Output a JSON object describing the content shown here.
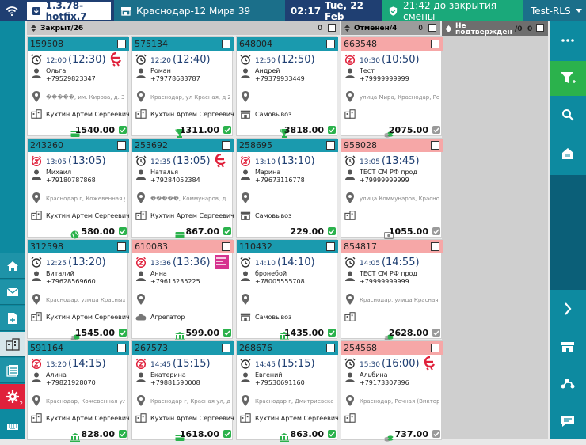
{
  "header": {
    "version": "1.3.78-hotfix.7",
    "store": "Краснодар-12 Мира 39",
    "time": "02:17",
    "date": "Tue, 22 Feb",
    "shift": "21:42 до закрытия смены",
    "user": "Test-RLS"
  },
  "columns": [
    {
      "title": "Закрыт/26",
      "count": "0"
    },
    {
      "title": "Отменен/4",
      "count": "0"
    },
    {
      "title": "Не подтвержден",
      "count": "/0",
      "count2": "0"
    }
  ],
  "cards": [
    {
      "id": "159508",
      "hdr": "teal",
      "time": "12:00",
      "eta": "(12:30)",
      "name": "Ольга",
      "phone": "+79529823347",
      "addr": "�����, им. Кирова, д. 3",
      "courier": "Кухтин Артем Сергеевич",
      "price": "1540.00",
      "pay": "card",
      "status": "g",
      "clock": "alarm",
      "brand": "e"
    },
    {
      "id": "575134",
      "hdr": "teal",
      "time": "12:20",
      "eta": "(12:40)",
      "name": "Роман",
      "phone": "+79778683787",
      "addr": "Краснодар, ул Красная, д 25/",
      "courier": "Кухтин Артем Сергеевич",
      "price": "1311.00",
      "pay": "trophy",
      "status": "g",
      "clock": "alarm",
      "brand": ""
    },
    {
      "id": "648004",
      "hdr": "teal",
      "time": "12:50",
      "eta": "(12:50)",
      "name": "Андрей",
      "phone": "+79379933449",
      "addr": "",
      "courier": "Самовывоз",
      "price": "3818.00",
      "pay": "trophy",
      "status": "g",
      "clock": "alarm",
      "brand": "",
      "courierIcon": "store"
    },
    {
      "id": "663548",
      "hdr": "pink",
      "time": "10:30",
      "eta": "(10:50)",
      "name": "Тест",
      "phone": "+79999999999",
      "addr": "улица Мира, Краснодар, Росс",
      "courier": "",
      "price": "2075.00",
      "pay": "coins",
      "status": "gr",
      "clock": "z",
      "brand": ""
    },
    {
      "id": "243260",
      "hdr": "teal",
      "time": "13:05",
      "eta": "(13:05)",
      "name": "Михаил",
      "phone": "+79180787868",
      "addr": "Краснодар г, Кожевенная ул,",
      "courier": "Кухтин Артем Сергеевич",
      "price": "580.00",
      "pay": "globe",
      "status": "g",
      "clock": "z",
      "brand": ""
    },
    {
      "id": "253692",
      "hdr": "teal",
      "time": "12:35",
      "eta": "(13:05)",
      "name": "Наталья",
      "phone": "+79284052384",
      "addr": "�����, Коммунаров, д. 7",
      "courier": "Кухтин Артем Сергеевич",
      "price": "867.00",
      "pay": "card",
      "status": "g",
      "clock": "alarm",
      "brand": "e"
    },
    {
      "id": "258695",
      "hdr": "teal",
      "time": "13:10",
      "eta": "(13:10)",
      "name": "Марина",
      "phone": "+79673116778",
      "addr": "",
      "courier": "Самовывоз",
      "price": "229.00",
      "pay": "",
      "status": "g",
      "clock": "z",
      "brand": "",
      "courierIcon": "store"
    },
    {
      "id": "958028",
      "hdr": "pink",
      "time": "13:05",
      "eta": "(13:45)",
      "name": "ТЕСТ СМ РФ прод",
      "phone": "+79999999999",
      "addr": "улица Коммунаров, Краснодар",
      "courier": "",
      "price": "1055.00",
      "pay": "cash",
      "status": "gr",
      "clock": "alarm",
      "brand": ""
    },
    {
      "id": "312598",
      "hdr": "teal",
      "time": "12:25",
      "eta": "(13:20)",
      "name": "Виталий",
      "phone": "+79628569660",
      "addr": "Краснодар, улица Красных П",
      "courier": "Кухтин Артем Сергеевич",
      "price": "1545.00",
      "pay": "coins",
      "status": "g",
      "clock": "alarm",
      "brand": ""
    },
    {
      "id": "610083",
      "hdr": "pink",
      "time": "13:36",
      "eta": "(13:36)",
      "name": "Анна",
      "phone": "+79615235225",
      "addr": "",
      "courier": "Агрегатор",
      "price": "599.00",
      "pay": "bank",
      "status": "g",
      "clock": "z",
      "brand": "delivery",
      "courierIcon": "cloud"
    },
    {
      "id": "110432",
      "hdr": "teal",
      "time": "14:10",
      "eta": "(14:10)",
      "name": "бронебой",
      "phone": "+78005555708",
      "addr": "",
      "courier": "Самовывоз",
      "price": "1435.00",
      "pay": "bank",
      "status": "g",
      "clock": "alarm",
      "brand": "",
      "courierIcon": "store"
    },
    {
      "id": "854817",
      "hdr": "pink",
      "time": "14:05",
      "eta": "(14:55)",
      "name": "ТЕСТ СМ РФ прод",
      "phone": "+79999999999",
      "addr": "Краснодар, улица Красная, 1:",
      "courier": "",
      "price": "2628.00",
      "pay": "coins",
      "status": "gr",
      "clock": "alarm",
      "brand": ""
    },
    {
      "id": "591164",
      "hdr": "teal",
      "time": "13:20",
      "eta": "(14:15)",
      "name": "Алина",
      "phone": "+79821928070",
      "addr": "Краснодар, Кожевенная улица",
      "courier": "Кухтин Артем Сергеевич",
      "price": "828.00",
      "pay": "bank",
      "status": "g",
      "clock": "z",
      "brand": ""
    },
    {
      "id": "267573",
      "hdr": "teal",
      "time": "14:45",
      "eta": "(15:15)",
      "name": "Екатерина",
      "phone": "+79881590008",
      "addr": "Краснодар г, Красная ул, д 1",
      "courier": "Кухтин Артем Сергеевич",
      "price": "1618.00",
      "pay": "card",
      "status": "g",
      "clock": "z",
      "brand": ""
    },
    {
      "id": "268676",
      "hdr": "teal",
      "time": "14:45",
      "eta": "(15:15)",
      "name": "Евгений",
      "phone": "+79530691160",
      "addr": "Краснодар г, Дмитриевская у",
      "courier": "Кухтин Артем Сергеевич",
      "price": "863.00",
      "pay": "bank",
      "status": "g",
      "clock": "alarm",
      "brand": ""
    },
    {
      "id": "254568",
      "hdr": "pink",
      "time": "15:30",
      "eta": "(16:00)",
      "name": "Альбина",
      "phone": "+79173307896",
      "addr": "Краснодар, Речная (Виктори",
      "courier": "",
      "price": "737.00",
      "pay": "coins",
      "status": "gr",
      "clock": "alarm",
      "brand": "e"
    }
  ],
  "colors": {
    "teal": "#1a9aae",
    "pink": "#f6a7a7",
    "green": "#2bb24c",
    "navy": "#1f3f72"
  }
}
